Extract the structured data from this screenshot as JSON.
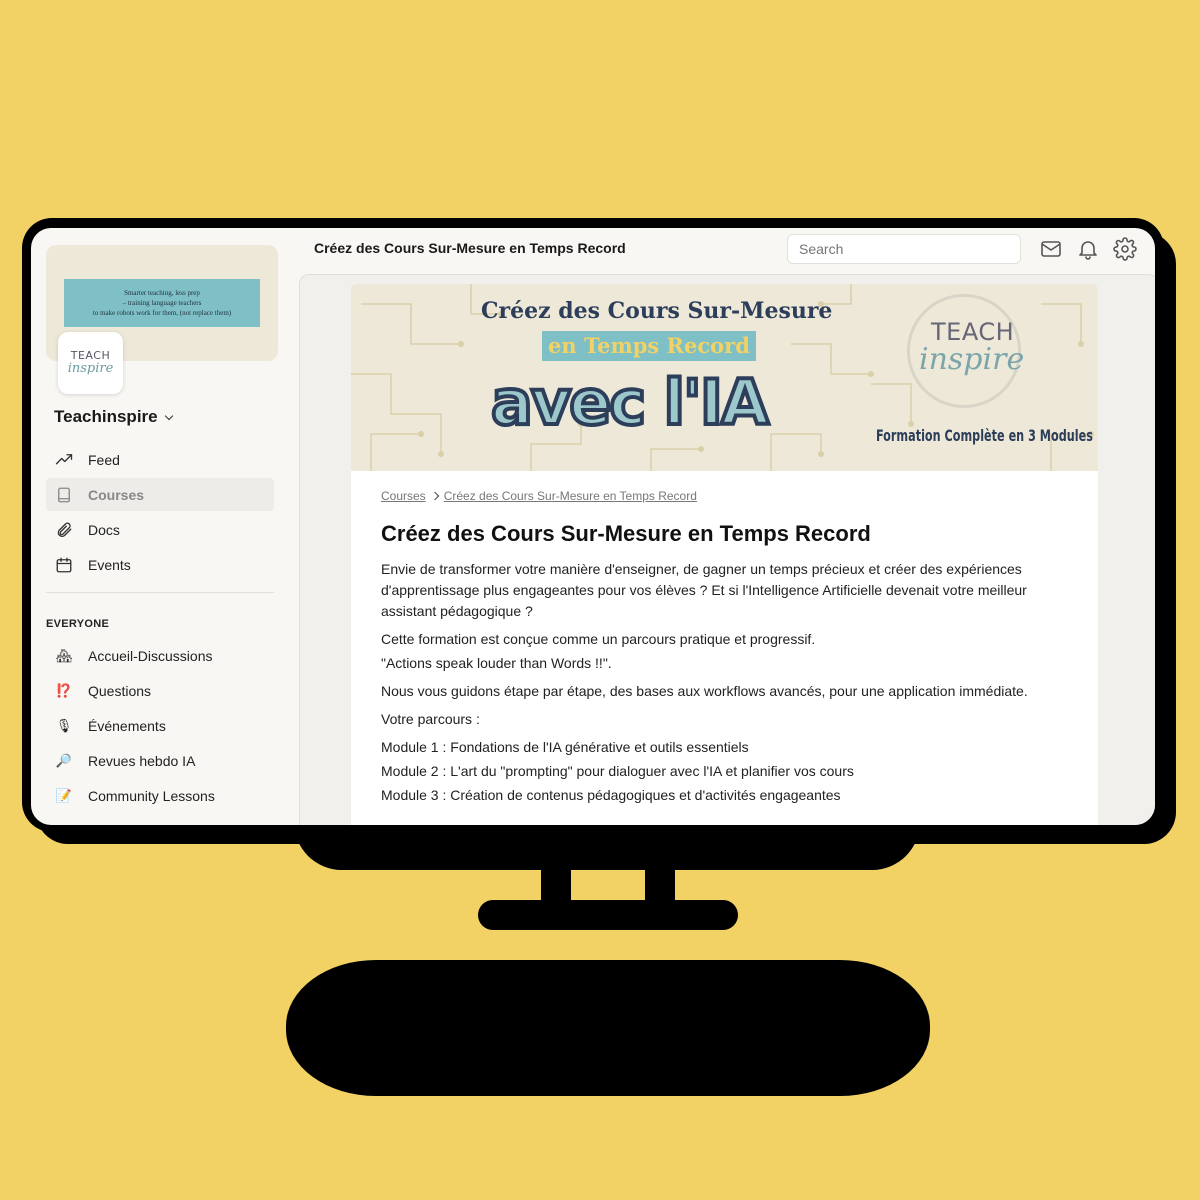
{
  "window": {
    "page_title": "Créez des Cours Sur-Mesure en Temps Record"
  },
  "sidebar": {
    "banner_line1": "Smarter teaching, less prep",
    "banner_line2": "– training language teachers",
    "banner_line3": "to make robots work for them, (not replace them)",
    "logo_teach": "TEACH",
    "logo_inspire": "inspire",
    "community_name": "Teachinspire",
    "nav": [
      {
        "label": "Feed",
        "icon": "trending-icon"
      },
      {
        "label": "Courses",
        "icon": "book-icon",
        "active": true
      },
      {
        "label": "Docs",
        "icon": "paperclip-icon"
      },
      {
        "label": "Events",
        "icon": "calendar-icon"
      }
    ],
    "section_label": "EVERYONE",
    "channels": [
      {
        "label": "Accueil-Discussions",
        "emoji": "🏘"
      },
      {
        "label": "Questions",
        "emoji": "⁉️"
      },
      {
        "label": "Événements",
        "emoji": "🎙"
      },
      {
        "label": "Revues hebdo IA",
        "emoji": "🔎"
      },
      {
        "label": "Community Lessons",
        "emoji": "📝"
      }
    ]
  },
  "header": {
    "search_placeholder": "Search",
    "icons": [
      "mail-icon",
      "bell-icon",
      "gear-icon"
    ]
  },
  "hero": {
    "line1": "Créez des Cours Sur-Mesure",
    "line2": "en Temps Record",
    "line3": "avec l'IA",
    "logo_teach": "TEACH",
    "logo_inspire": "inspire",
    "formation": "Formation Complète en 3 Modules"
  },
  "content": {
    "breadcrumb_root": "Courses",
    "breadcrumb_current": "Créez des Cours Sur-Mesure en Temps Record",
    "title": "Créez des Cours Sur-Mesure en Temps Record",
    "p1": "Envie de transformer votre manière d'enseigner, de gagner un temps précieux et créer des expériences d'apprentissage plus engageantes pour vos élèves ? Et si l'Intelligence Artificielle devenait votre meilleur assistant pédagogique ?",
    "p2": "Cette formation est conçue comme un parcours pratique et progressif.",
    "p3": "\"Actions speak louder than Words !!\".",
    "p4": "Nous vous guidons étape par étape, des bases aux workflows avancés, pour une application immédiate.",
    "p5": "Votre parcours :",
    "modules": [
      "Module 1 : Fondations de l'IA générative et outils essentiels",
      "Module 2 : L'art du \"prompting\" pour dialoguer avec l'IA et planifier vos cours",
      "Module 3 : Création de contenus pédagogiques et d'activités engageantes"
    ]
  },
  "colors": {
    "background": "#F2D264",
    "accent_teal": "#7EC0C6",
    "navy": "#2c3e5a"
  }
}
